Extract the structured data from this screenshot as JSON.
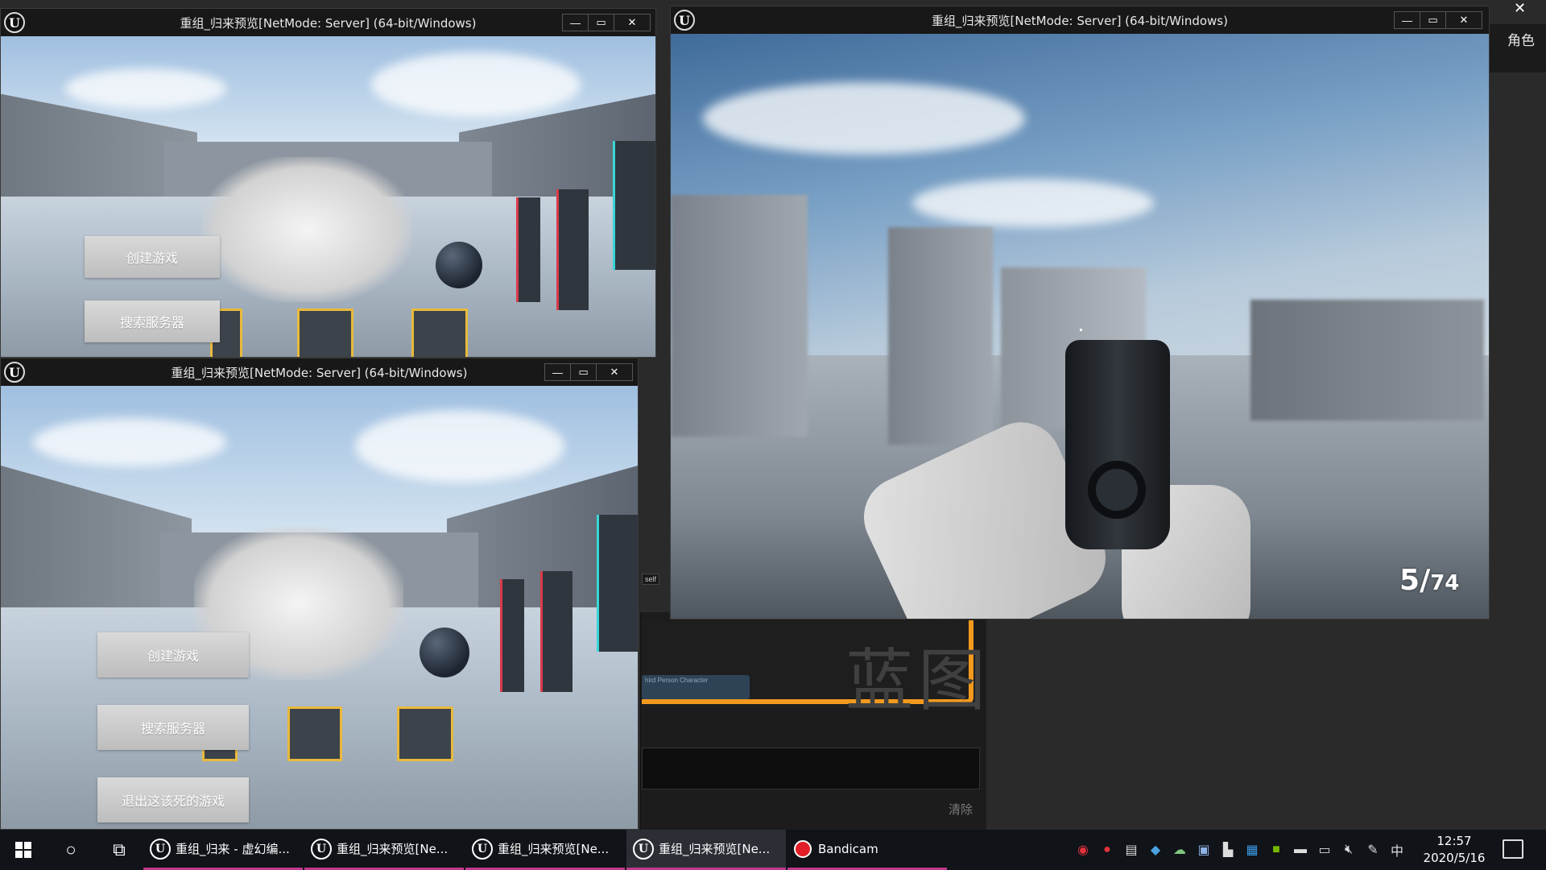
{
  "editor": {
    "right_tab_label": "角色",
    "blueprint_watermark": "蓝图",
    "node_label": "hird Person Character",
    "self_label": "self",
    "clear_label": "清除"
  },
  "windows": [
    {
      "title": "重组_归来预览[NetMode: Server] (64-bit/Windows)",
      "buttons": [
        "创建游戏",
        "搜索服务器"
      ]
    },
    {
      "title": "重组_归来预览[NetMode: Server] (64-bit/Windows)",
      "buttons": [
        "创建游戏",
        "搜索服务器",
        "退出这该死的游戏"
      ]
    },
    {
      "title": "重组_归来预览[NetMode: Server] (64-bit/Windows)",
      "ammo_current": "5",
      "ammo_separator": "/",
      "ammo_total": "74"
    }
  ],
  "taskbar": {
    "tasks": [
      {
        "label": "重组_归来 - 虚幻编...",
        "icon": "unreal-icon"
      },
      {
        "label": "重组_归来预览[Ne...",
        "icon": "unreal-icon"
      },
      {
        "label": "重组_归来预览[Ne...",
        "icon": "unreal-icon"
      },
      {
        "label": "重组_归来预览[Ne...",
        "icon": "unreal-icon"
      },
      {
        "label": "Bandicam",
        "icon": "record-icon"
      }
    ],
    "ime": "中",
    "time": "12:57",
    "date": "2020/5/16"
  },
  "colors": {
    "accent_task": "#c4378e",
    "bp_orange": "#f39a1e",
    "block_outline": "#e8b93c"
  }
}
